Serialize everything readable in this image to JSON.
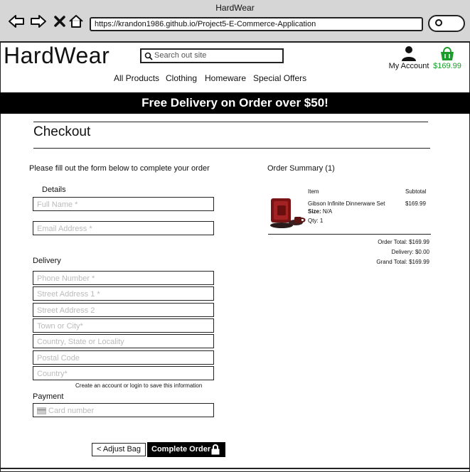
{
  "browser": {
    "window_title": "HardWear",
    "url": "https://krandon1986.github.io/Project5-E-Commerce-Application"
  },
  "header": {
    "logo": "HardWear",
    "search_placeholder": "Search out site",
    "account_label": "My Account",
    "bag_total": "$169.99",
    "nav": [
      "All Products",
      "Clothing",
      "Homeware",
      "Special Offers"
    ]
  },
  "banner": {
    "text": "Free Delivery on Order over $50!"
  },
  "checkout": {
    "title": "Checkout",
    "intro": "Please fill out the form below to complete your order",
    "details_label": "Details",
    "delivery_label": "Delivery",
    "payment_label": "Payment",
    "fields": {
      "full_name": "Full Name *",
      "email": "Email Address *",
      "phone": "Phone Number *",
      "street1": "Street Address 1 *",
      "street2": "Street Address 2",
      "town": "Town or City*",
      "county": "Country, State or Locality",
      "postcode": "Postal Code",
      "country": "Country*",
      "card": "Card number"
    },
    "save_note": "Create an account or login to save this information",
    "adjust_bag": "< Adjust Bag",
    "complete_order": "Complete Order"
  },
  "summary": {
    "title": "Order Summary (1)",
    "col_item": "Item",
    "col_subtotal": "Subtotal",
    "item": {
      "name": "Gibson Infinite Dinnerware Set",
      "size_label": "Size:",
      "size_value": "N/A",
      "qty": "Qty: 1",
      "subtotal": "$169.99"
    },
    "order_total": "Order Total: $169.99",
    "delivery": "Delivery: $0.00",
    "grand_total": "Grand Total: $169.99"
  },
  "colors": {
    "accent_green": "#1a9c2a",
    "banner_bg": "#000000"
  }
}
